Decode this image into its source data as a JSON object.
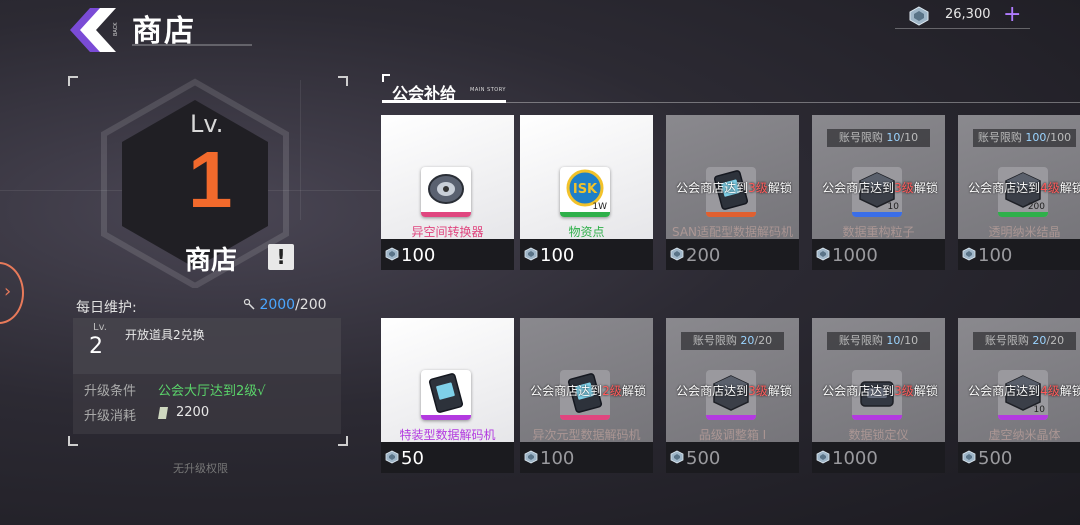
{
  "header": {
    "title": "商店",
    "back_label": "BACK",
    "currency": {
      "value": "26,300",
      "plus": "+"
    }
  },
  "shop_panel": {
    "lv_label": "Lv.",
    "level": "1",
    "name": "商店",
    "excl": "!"
  },
  "maintenance": {
    "label": "每日维护:",
    "current": "2000",
    "max": "/200"
  },
  "upgrade": {
    "lv_label": "Lv.",
    "next_level": "2",
    "description": "开放道具2兑换",
    "condition_label": "升级条件",
    "condition_value": "公会大厅达到2级√",
    "cost_label": "升级消耗",
    "cost_value": "2200",
    "no_permission": "无升级权限"
  },
  "section": {
    "title": "公会补给",
    "subtitle": "MAIN STORY"
  },
  "cards": [
    {
      "name": "异空间转换器",
      "price": "100",
      "locked": false,
      "stripe": "#e0467f",
      "limit": null,
      "lock_text": null,
      "qty": "",
      "icon": "compass-icon"
    },
    {
      "name": "物资点",
      "price": "100",
      "locked": false,
      "stripe": "#2fb04a",
      "limit": null,
      "lock_text": null,
      "qty": "1W",
      "icon": "isk-coin-icon"
    },
    {
      "name": "SAN适配型数据解码机",
      "price": "200",
      "locked": true,
      "stripe": "#e06030",
      "limit": null,
      "lock_text": {
        "pre": "公会商店达到",
        "lv": "3级",
        "post": "解锁"
      },
      "qty": "",
      "icon": "decoder-icon"
    },
    {
      "name": "数据重构粒子",
      "price": "1000",
      "locked": true,
      "stripe": "#3a6ee8",
      "limit": {
        "label": "账号限购 ",
        "n": "10",
        "m": "/10"
      },
      "lock_text": {
        "pre": "公会商店达到",
        "lv": "3级",
        "post": "解锁"
      },
      "qty": "10",
      "icon": "cube-icon"
    },
    {
      "name": "透明纳米结晶",
      "price": "100",
      "locked": true,
      "stripe": "#2fb04a",
      "limit": {
        "label": "账号限购 ",
        "n": "100",
        "m": "/100"
      },
      "lock_text": {
        "pre": "公会商店达到",
        "lv": "4级",
        "post": "解锁"
      },
      "qty": "200",
      "icon": "crystal-box-icon"
    },
    {
      "name": "特装型数据解码机",
      "price": "50",
      "locked": false,
      "stripe": "#b33ae0",
      "limit": null,
      "lock_text": null,
      "qty": "",
      "icon": "decoder-icon"
    },
    {
      "name": "异次元型数据解码机",
      "price": "100",
      "locked": true,
      "stripe": "#e0467f",
      "limit": null,
      "lock_text": {
        "pre": "公会商店达到",
        "lv": "2级",
        "post": "解锁"
      },
      "qty": "",
      "icon": "decoder-icon"
    },
    {
      "name": "品级调整箱 Ⅰ",
      "price": "500",
      "locked": true,
      "stripe": "#b33ae0",
      "limit": {
        "label": "账号限购 ",
        "n": "20",
        "m": "/20"
      },
      "lock_text": {
        "pre": "公会商店达到",
        "lv": "3级",
        "post": "解锁"
      },
      "qty": "",
      "icon": "box-icon"
    },
    {
      "name": "数据锁定仪",
      "price": "1000",
      "locked": true,
      "stripe": "#b33ae0",
      "limit": {
        "label": "账号限购 ",
        "n": "10",
        "m": "/10"
      },
      "lock_text": {
        "pre": "公会商店达到",
        "lv": "3级",
        "post": "解锁"
      },
      "qty": "",
      "icon": "lock-device-icon"
    },
    {
      "name": "虚空纳米晶体",
      "price": "500",
      "locked": true,
      "stripe": "#b33ae0",
      "limit": {
        "label": "账号限购 ",
        "n": "20",
        "m": "/20"
      },
      "lock_text": {
        "pre": "公会商店达到",
        "lv": "4级",
        "post": "解锁"
      },
      "qty": "10",
      "icon": "crystal-box-icon"
    }
  ],
  "colors": {
    "accent_orange": "#f26a2c",
    "accent_purple": "#b07cff",
    "accent_blue": "#4aa6ff",
    "ok_green": "#5ad46a"
  }
}
